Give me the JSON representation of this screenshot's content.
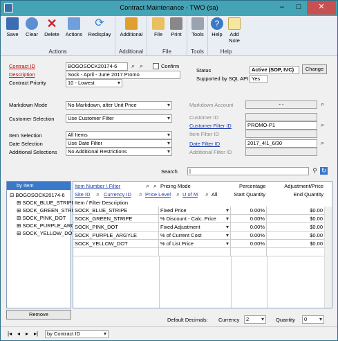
{
  "window": {
    "title": "Contract Maintenance  -  TWO (sa)"
  },
  "ribbon": {
    "groups": [
      {
        "label": "Actions",
        "buttons": [
          "Save",
          "Clear",
          "Delete",
          "Actions",
          "Redisplay"
        ]
      },
      {
        "label": "Additional",
        "buttons": [
          "Additional"
        ]
      },
      {
        "label": "File",
        "buttons": [
          "File",
          "Print"
        ]
      },
      {
        "label": "Tools",
        "buttons": [
          "Tools"
        ]
      },
      {
        "label": "Help",
        "buttons": [
          "Help",
          "Add Note"
        ]
      }
    ]
  },
  "header": {
    "contract_id_label": "Contract ID",
    "contract_id": "BOGOSOCK20174-6",
    "confirm_label": "Confirm",
    "description_label": "Description",
    "description": "Sock - April - June 2017 Promo",
    "priority_label": "Contract Priority",
    "priority": "10 - Lowest",
    "status_label": "Status",
    "status": "Active (SOP, IVC)",
    "change_button": "Change",
    "supported_label": "Supported by SQL API",
    "supported": "Yes"
  },
  "selection": {
    "markdown_mode_label": "Markdown Mode",
    "markdown_mode": "No Markdown, alter Unit Price",
    "customer_selection_label": "Customer Selection",
    "customer_selection": "Use Customer Filter",
    "item_selection_label": "Item Selection",
    "item_selection": "All Items",
    "date_selection_label": "Date Selection",
    "date_selection": "Use Date Filter",
    "additional_selections_label": "Additional Selections",
    "additional_selections": "No Additional Restrictions",
    "markdown_account_label": "Markdown Account",
    "markdown_account": "-   -",
    "customer_id_label": "Customer ID",
    "customer_filter_id_label": "Customer Filter ID",
    "customer_filter_id": "PROMO-P1",
    "item_filter_id_label": "Item Filter ID",
    "date_filter_id_label": "Date Filter ID",
    "date_filter_id": "2017_4/1_6/30",
    "additional_filter_id_label": "Additional Filter ID"
  },
  "search": {
    "label": "Search",
    "value": "|"
  },
  "tree": {
    "header": "by Item",
    "root": "BOGOSOCK20174-6",
    "items": [
      "SOCK_BLUE_STRIPE",
      "SOCK_GREEN_STRIPE",
      "SOCK_PINK_DOT",
      "SOCK_PURPLE_ARGYLE",
      "SOCK_YELLOW_DOT"
    ],
    "remove_button": "Remove"
  },
  "grid": {
    "hdr1": {
      "item_number": "Item Number \\ Filter",
      "pricing_mode": "Pricing Mode",
      "percentage": "Percentage",
      "adjustment": "Adjustment/Price"
    },
    "hdr2": {
      "site_id": "Site ID",
      "currency_id": "Currency ID",
      "price_level": "Price Level",
      "u_of_m": "U of M",
      "all": "All",
      "start_qty": "Start Quantity",
      "end_qty": "End Quantity"
    },
    "hdr3": {
      "description": "Item / Filter Description"
    },
    "rows": [
      {
        "item": "SOCK_BLUE_STRIPE",
        "mode": "Fixed Price",
        "pct": "0.00%",
        "amt": "$0.00"
      },
      {
        "item": "SOCK_GREEN_STRIPE",
        "mode": "% Discount - Calc. Price",
        "pct": "0.00%",
        "amt": "$0.00"
      },
      {
        "item": "SOCK_PINK_DOT",
        "mode": "Fixed Adjustment",
        "pct": "0.00%",
        "amt": "$0.00"
      },
      {
        "item": "SOCK_PURPLE_ARGYLE",
        "mode": "% of Current Cost",
        "pct": "0.00%",
        "amt": "$0.00"
      },
      {
        "item": "SOCK_YELLOW_DOT",
        "mode": "% of List Price",
        "pct": "0.00%",
        "amt": "$0.00"
      }
    ]
  },
  "footer": {
    "default_decimals_label": "Default Decimals:",
    "currency_label": "Currency",
    "currency": "2",
    "quantity_label": "Quantity",
    "quantity": "0",
    "sort_by": "by Contract ID"
  }
}
